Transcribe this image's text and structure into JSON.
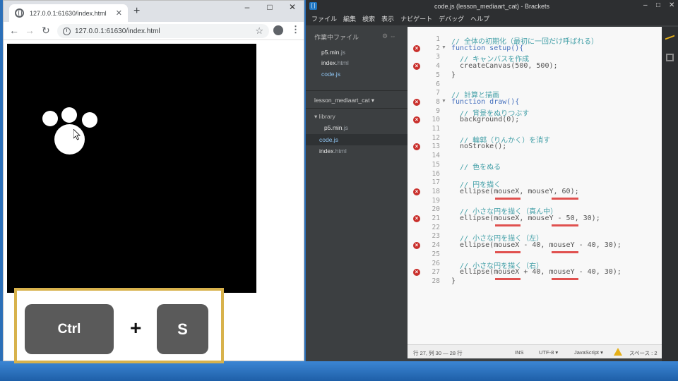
{
  "browser": {
    "tab_title": "127.0.0.1:61630/index.html",
    "url": "127.0.0.1:61630/index.html",
    "window_controls": [
      "–",
      "□",
      "✕"
    ]
  },
  "keys": {
    "ctrl": "Ctrl",
    "plus": "+",
    "s": "S"
  },
  "brackets": {
    "title": "code.js (lesson_mediaart_cat) - Brackets",
    "menu": [
      "ファイル",
      "編集",
      "検索",
      "表示",
      "ナビゲート",
      "デバッグ",
      "ヘルプ"
    ],
    "working_files_header": "作業中ファイル",
    "working_files": [
      {
        "name": "p5.min",
        "ext": ".js"
      },
      {
        "name": "index",
        "ext": ".html"
      },
      {
        "name": "code",
        "ext": ".js"
      }
    ],
    "project_name": "lesson_mediaart_cat ▾",
    "tree": [
      {
        "name": "▾ library",
        "ext": ""
      },
      {
        "name": "p5.min",
        "ext": ".js"
      },
      {
        "name": "code",
        "ext": ".js"
      },
      {
        "name": "index",
        "ext": ".html"
      }
    ],
    "code_lines": [
      {
        "n": "1",
        "text": "// 全体の初期化（最初に一回だけ呼ばれる）",
        "type": "comment",
        "err": false,
        "fold": false
      },
      {
        "n": "2",
        "text": "function setup(){",
        "type": "kw",
        "err": true,
        "fold": true
      },
      {
        "n": "3",
        "text": "  // キャンバスを作成",
        "type": "comment",
        "err": false,
        "fold": false
      },
      {
        "n": "4",
        "text": "  createCanvas(500, 500);",
        "type": "code",
        "err": true,
        "fold": false
      },
      {
        "n": "5",
        "text": "}",
        "type": "code",
        "err": false,
        "fold": false
      },
      {
        "n": "6",
        "text": "",
        "type": "code",
        "err": false,
        "fold": false
      },
      {
        "n": "7",
        "text": "// 計算と描画",
        "type": "comment",
        "err": false,
        "fold": false
      },
      {
        "n": "8",
        "text": "function draw(){",
        "type": "kw",
        "err": true,
        "fold": true
      },
      {
        "n": "9",
        "text": "  // 背景をぬりつぶす",
        "type": "comment",
        "err": false,
        "fold": false
      },
      {
        "n": "10",
        "text": "  background(0);",
        "type": "code",
        "err": true,
        "fold": false
      },
      {
        "n": "11",
        "text": "",
        "type": "code",
        "err": false,
        "fold": false
      },
      {
        "n": "12",
        "text": "  // 輪郭（りんかく）を消す",
        "type": "comment",
        "err": false,
        "fold": false
      },
      {
        "n": "13",
        "text": "  noStroke();",
        "type": "code",
        "err": true,
        "fold": false
      },
      {
        "n": "14",
        "text": "",
        "type": "code",
        "err": false,
        "fold": false
      },
      {
        "n": "15",
        "text": "  // 色をぬる",
        "type": "comment",
        "err": false,
        "fold": false
      },
      {
        "n": "16",
        "text": "",
        "type": "code",
        "err": false,
        "fold": false
      },
      {
        "n": "17",
        "text": "  // 円を描く",
        "type": "comment",
        "err": false,
        "fold": false
      },
      {
        "n": "18",
        "text": "  ellipse(mouseX, mouseY, 60);",
        "type": "code",
        "err": true,
        "fold": false
      },
      {
        "n": "19",
        "text": "",
        "type": "code",
        "err": false,
        "fold": false
      },
      {
        "n": "20",
        "text": "  // 小さな円を描く（真ん中）",
        "type": "comment",
        "err": false,
        "fold": false
      },
      {
        "n": "21",
        "text": "  ellipse(mouseX, mouseY - 50, 30);",
        "type": "code",
        "err": true,
        "fold": false
      },
      {
        "n": "22",
        "text": "",
        "type": "code",
        "err": false,
        "fold": false
      },
      {
        "n": "23",
        "text": "  // 小さな円を描く（左）",
        "type": "comment",
        "err": false,
        "fold": false
      },
      {
        "n": "24",
        "text": "  ellipse(mouseX - 40, mouseY - 40, 30);",
        "type": "code",
        "err": true,
        "fold": false
      },
      {
        "n": "25",
        "text": "",
        "type": "code",
        "err": false,
        "fold": false
      },
      {
        "n": "26",
        "text": "  // 小さな円を描く（右）",
        "type": "comment",
        "err": false,
        "fold": false
      },
      {
        "n": "27",
        "text": "  ellipse(mouseX + 40, mouseY - 40, 30);",
        "type": "code",
        "err": true,
        "fold": false
      },
      {
        "n": "28",
        "text": "}",
        "type": "code",
        "err": false,
        "fold": false
      }
    ],
    "status": {
      "position": "行 27, 列 30 — 28 行",
      "ins": "INS",
      "encoding": "UTF-8 ▾",
      "language": "JavaScript ▾",
      "spaces": "スペース : 2"
    }
  },
  "colors": {
    "accent": "#d8b24c",
    "error": "#c9302c",
    "comment": "#44a0a8",
    "keyword": "#446fbd"
  }
}
